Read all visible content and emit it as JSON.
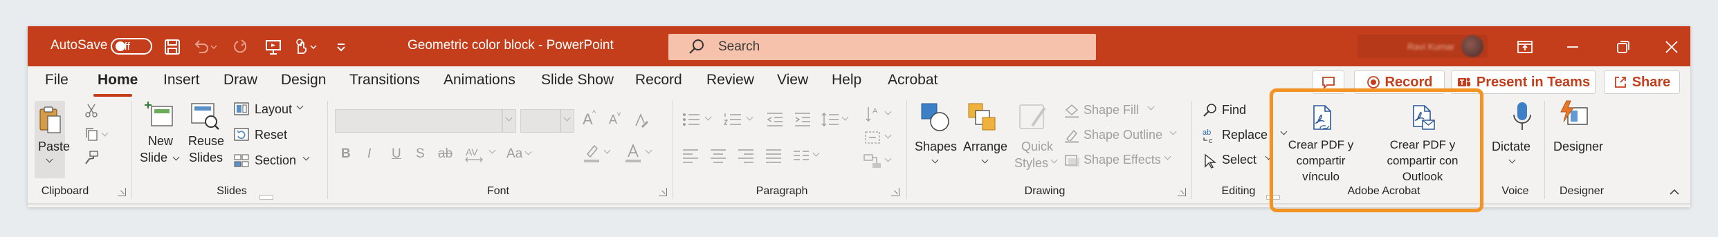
{
  "titlebar": {
    "autosave_label": "AutoSave",
    "autosave_state": "Off",
    "doc_title": "Geometric color block  -  PowerPoint",
    "search_placeholder": "Search",
    "account_name": "Ravi Kumar"
  },
  "tabs": [
    "File",
    "Home",
    "Insert",
    "Draw",
    "Design",
    "Transitions",
    "Animations",
    "Slide Show",
    "Record",
    "Review",
    "View",
    "Help",
    "Acrobat"
  ],
  "active_tab": "Home",
  "right_buttons": {
    "record": "Record",
    "present": "Present in Teams",
    "share": "Share"
  },
  "clipboard": {
    "paste": "Paste",
    "group": "Clipboard"
  },
  "slides": {
    "new_slide_1": "New",
    "new_slide_2": "Slide",
    "reuse_1": "Reuse",
    "reuse_2": "Slides",
    "layout": "Layout",
    "reset": "Reset",
    "section": "Section",
    "group": "Slides"
  },
  "font": {
    "bold": "B",
    "italic": "I",
    "underline": "U",
    "shadow": "S",
    "strike": "ab",
    "grow": "A",
    "shrink": "A",
    "case": "Aa",
    "group": "Font"
  },
  "paragraph": {
    "group": "Paragraph"
  },
  "drawing": {
    "shapes": "Shapes",
    "arrange": "Arrange",
    "quick_1": "Quick",
    "quick_2": "Styles",
    "fill": "Shape Fill",
    "outline": "Shape Outline",
    "effects": "Shape Effects",
    "group": "Drawing"
  },
  "editing": {
    "find": "Find",
    "replace": "Replace",
    "select": "Select",
    "group": "Editing"
  },
  "acrobat": {
    "pdf1_l1": "Crear PDF y",
    "pdf1_l2": "compartir",
    "pdf1_l3": "vínculo",
    "pdf2_l1": "Crear PDF y",
    "pdf2_l2": "compartir con",
    "pdf2_l3": "Outlook",
    "group": "Adobe Acrobat"
  },
  "voice": {
    "dictate": "Dictate",
    "group": "Voice"
  },
  "designer": {
    "designer": "Designer",
    "group": "Designer"
  },
  "colors": {
    "accent": "#c43e1c",
    "highlight": "#f29423",
    "search_bg": "#f7c2ac"
  }
}
